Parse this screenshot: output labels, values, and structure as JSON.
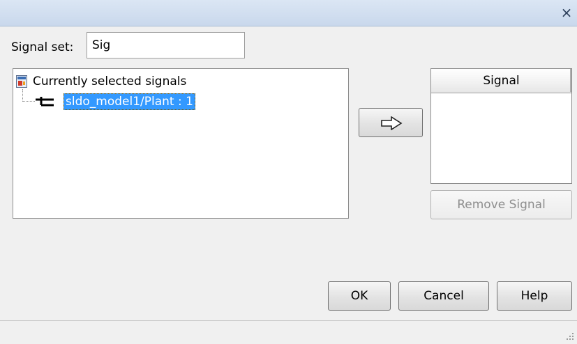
{
  "window": {
    "close_glyph": "×"
  },
  "signal_set": {
    "label": "Signal set:",
    "value": "Sig"
  },
  "tree": {
    "root_label": "Currently selected signals",
    "root_icon": "model-block-icon",
    "children": [
      {
        "label": "sldo_model1/Plant : 1",
        "icon": "signal-line-icon",
        "selected": true
      }
    ]
  },
  "add_button": {
    "icon": "right-arrow-icon"
  },
  "signal_list": {
    "header": "Signal",
    "items": []
  },
  "remove_button": {
    "label": "Remove Signal",
    "enabled": false
  },
  "footer": {
    "ok_label": "OK",
    "cancel_label": "Cancel",
    "help_label": "Help"
  },
  "colors": {
    "selection": "#3399ff",
    "titlebar": "#c9d8ec"
  }
}
